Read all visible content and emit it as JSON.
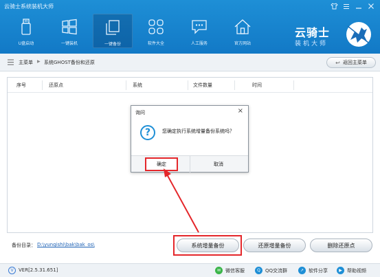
{
  "window": {
    "title": "云骑士系统装机大师",
    "controls": [
      "shirt-icon",
      "menu-icon",
      "minimize-icon",
      "close-icon"
    ]
  },
  "nav": {
    "items": [
      {
        "label": "U盘启动",
        "icon": "usb-icon",
        "active": false
      },
      {
        "label": "一键装机",
        "icon": "windows-icon",
        "active": false
      },
      {
        "label": "一键备份",
        "icon": "backup-icon",
        "active": true
      },
      {
        "label": "软件大全",
        "icon": "apps-grid-icon",
        "active": false
      },
      {
        "label": "人工服务",
        "icon": "chat-service-icon",
        "active": false
      },
      {
        "label": "官方网站",
        "icon": "home-icon",
        "active": false
      }
    ]
  },
  "logo": {
    "main": "云骑士",
    "sub": "装机大师"
  },
  "breadcrumb": {
    "home": "主菜单",
    "separator": "▶",
    "page": "系统GHOST备份和还原",
    "back_button": "返回主菜单"
  },
  "table": {
    "columns": [
      "序号",
      "还原点",
      "系统",
      "文件数量",
      "时间"
    ],
    "rows": []
  },
  "bottom": {
    "backup_dir_label": "备份目录：",
    "backup_dir_path": "D:\\yunqishi\\bak\\bak_os\\",
    "buttons": [
      "系统增量备份",
      "还原增量备份",
      "删除还原点"
    ]
  },
  "status": {
    "version": "VER[2.5.31.651]",
    "items": [
      {
        "label": "微信客服",
        "icon": "wechat-icon",
        "color": "#3bb54a"
      },
      {
        "label": "QQ交流群",
        "icon": "qq-icon",
        "color": "#1e8fd6"
      },
      {
        "label": "软件分享",
        "icon": "share-icon",
        "color": "#1e8fd6"
      },
      {
        "label": "帮助视频",
        "icon": "help-video-icon",
        "color": "#1e8fd6"
      }
    ]
  },
  "dialog": {
    "title": "询问",
    "message": "您确定执行系统增量备份系统吗？",
    "ok": "确定",
    "cancel": "取消"
  },
  "colors": {
    "header": "#1e8fd6",
    "highlight": "#e4262a",
    "link": "#1a5fb4"
  }
}
